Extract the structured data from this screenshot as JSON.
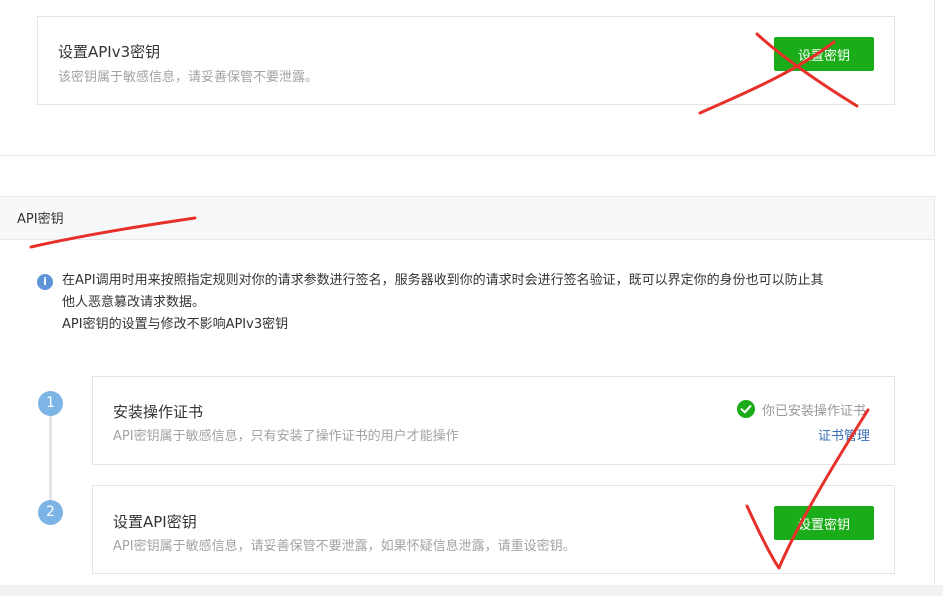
{
  "v3_card": {
    "title": "设置APIv3密钥",
    "desc": "该密钥属于敏感信息，请妥善保管不要泄露。",
    "button": "设置密钥"
  },
  "api_section": {
    "title": "API密钥",
    "info_line1": "在API调用时用来按照指定规则对你的请求参数进行签名，服务器收到你的请求时会进行签名验证，既可以界定你的身份也可以防止其",
    "info_line2": "他人恶意篡改请求数据。",
    "info_line3": "API密钥的设置与修改不影响APIv3密钥"
  },
  "steps": [
    {
      "number": "1",
      "title": "安装操作证书",
      "desc": "API密钥属于敏感信息，只有安装了操作证书的用户才能操作",
      "status": "你已安装操作证书",
      "link": "证书管理"
    },
    {
      "number": "2",
      "title": "设置API密钥",
      "desc": "API密钥属于敏感信息，请妥善保管不要泄露，如果怀疑信息泄露，请重设密钥。",
      "button": "设置密钥"
    }
  ],
  "annotation_color": "#e8302b",
  "accent_green": "#1aad19"
}
